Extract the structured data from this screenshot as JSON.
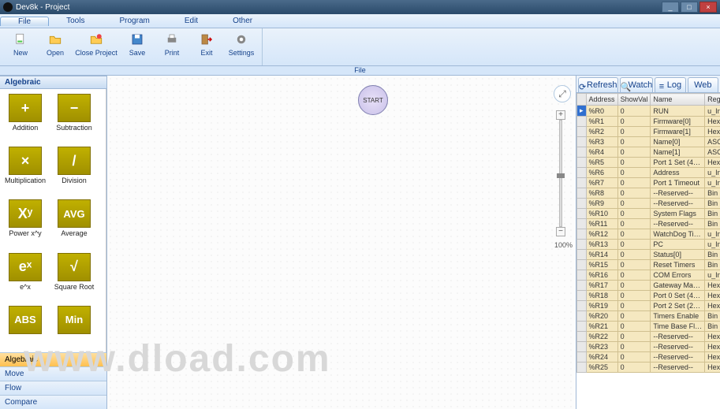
{
  "window": {
    "title": "Dev8k - Project"
  },
  "menu": {
    "file": "File",
    "tools": "Tools",
    "program": "Program",
    "edit": "Edit",
    "other": "Other"
  },
  "ribbon": {
    "new": "New",
    "open": "Open",
    "close": "Close Project",
    "save": "Save",
    "print": "Print",
    "exit": "Exit",
    "settings": "Settings",
    "group_label": "File"
  },
  "palette": {
    "header": "Algebraic",
    "items": [
      {
        "sym": "+",
        "label": "Addition"
      },
      {
        "sym": "−",
        "label": "Subtraction"
      },
      {
        "sym": "×",
        "label": "Multiplication"
      },
      {
        "sym": "/",
        "label": "Division"
      },
      {
        "sym": "Xʸ",
        "label": "Power x^y"
      },
      {
        "sym": "AVG",
        "label": "Average"
      },
      {
        "sym": "eˣ",
        "label": "e^x"
      },
      {
        "sym": "√",
        "label": "Square Root"
      },
      {
        "sym": "ABS",
        "label": ""
      },
      {
        "sym": "Min",
        "label": ""
      }
    ],
    "categories": [
      {
        "label": "Algebraic",
        "active": true
      },
      {
        "label": "Move",
        "active": false
      },
      {
        "label": "Flow",
        "active": false
      },
      {
        "label": "Compare",
        "active": false
      }
    ]
  },
  "canvas": {
    "start_label": "START",
    "zoom": "100%"
  },
  "watch": {
    "tabs": {
      "refresh": "Refresh",
      "watch": "Watch",
      "log": "Log",
      "web": "Web"
    },
    "headers": {
      "addr": "Address",
      "show": "ShowVal",
      "name": "Name",
      "regtype": "RegisterType"
    },
    "rows": [
      {
        "addr": "%R0",
        "show": "0",
        "name": "RUN",
        "type": "u_Int",
        "sel": true
      },
      {
        "addr": "%R1",
        "show": "0",
        "name": "Firmware[0]",
        "type": "Hex"
      },
      {
        "addr": "%R2",
        "show": "0",
        "name": "Firmware[1]",
        "type": "Hex"
      },
      {
        "addr": "%R3",
        "show": "0",
        "name": "Name[0]",
        "type": "ASCII"
      },
      {
        "addr": "%R4",
        "show": "0",
        "name": "Name[1]",
        "type": "ASCII"
      },
      {
        "addr": "%R5",
        "show": "0",
        "name": "Port 1 Set (4…",
        "type": "Hex"
      },
      {
        "addr": "%R6",
        "show": "0",
        "name": "Address",
        "type": "u_Int"
      },
      {
        "addr": "%R7",
        "show": "0",
        "name": "Port 1 Timeout",
        "type": "u_Int"
      },
      {
        "addr": "%R8",
        "show": "0",
        "name": "--Reserved--",
        "type": "Bin"
      },
      {
        "addr": "%R9",
        "show": "0",
        "name": "--Reserved--",
        "type": "Bin"
      },
      {
        "addr": "%R10",
        "show": "0",
        "name": "System Flags",
        "type": "Bin"
      },
      {
        "addr": "%R11",
        "show": "0",
        "name": "--Reserved--",
        "type": "Bin"
      },
      {
        "addr": "%R12",
        "show": "0",
        "name": "WatchDog Ti…",
        "type": "u_Int"
      },
      {
        "addr": "%R13",
        "show": "0",
        "name": "PC",
        "type": "u_Int"
      },
      {
        "addr": "%R14",
        "show": "0",
        "name": "Status[0]",
        "type": "Bin"
      },
      {
        "addr": "%R15",
        "show": "0",
        "name": "Reset Timers",
        "type": "Bin"
      },
      {
        "addr": "%R16",
        "show": "0",
        "name": "COM Errors",
        "type": "u_Int"
      },
      {
        "addr": "%R17",
        "show": "0",
        "name": "Gateway Ma…",
        "type": "Hex"
      },
      {
        "addr": "%R18",
        "show": "0",
        "name": "Port 0 Set (4…",
        "type": "Hex"
      },
      {
        "addr": "%R19",
        "show": "0",
        "name": "Port 2 Set (2…",
        "type": "Hex"
      },
      {
        "addr": "%R20",
        "show": "0",
        "name": "Timers Enable",
        "type": "Bin"
      },
      {
        "addr": "%R21",
        "show": "0",
        "name": "Time Base Fl…",
        "type": "Bin"
      },
      {
        "addr": "%R22",
        "show": "0",
        "name": "--Reserved--",
        "type": "Hex"
      },
      {
        "addr": "%R23",
        "show": "0",
        "name": "--Reserved--",
        "type": "Hex"
      },
      {
        "addr": "%R24",
        "show": "0",
        "name": "--Reserved--",
        "type": "Hex"
      },
      {
        "addr": "%R25",
        "show": "0",
        "name": "--Reserved--",
        "type": "Hex"
      }
    ]
  },
  "watermark": "www.dload.com"
}
